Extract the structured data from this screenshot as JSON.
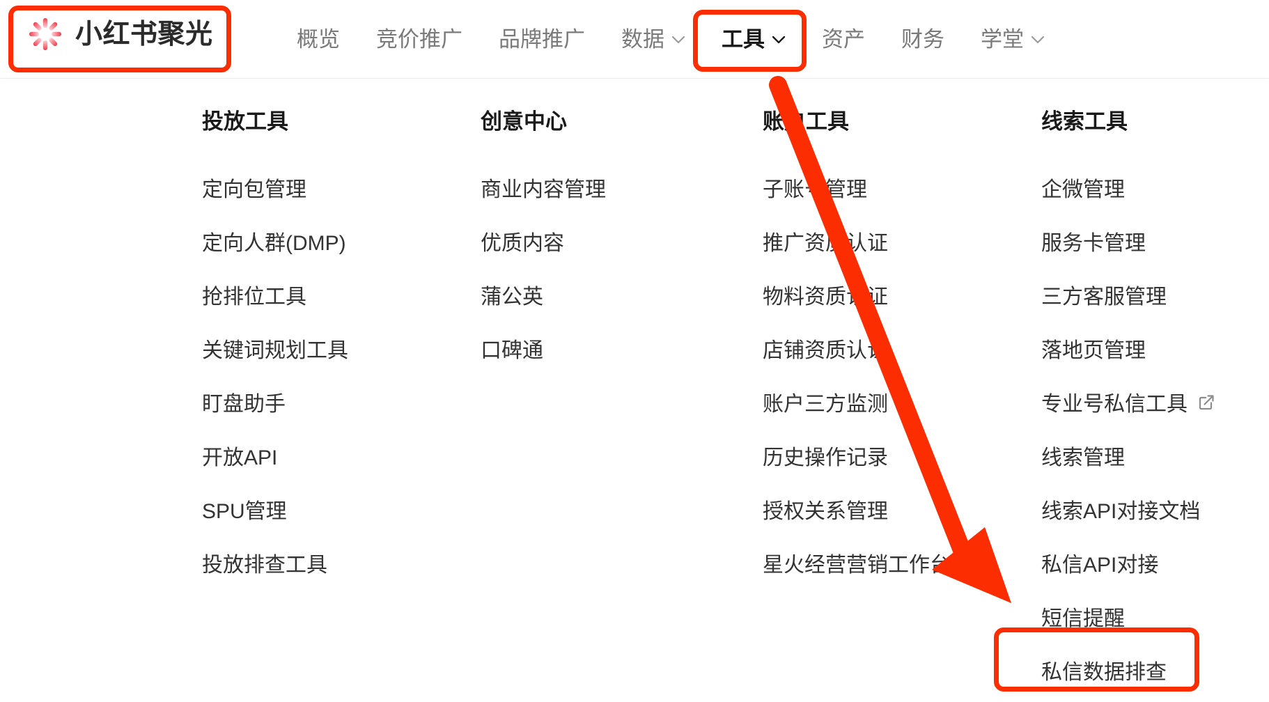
{
  "brand": {
    "name": "小红书聚光",
    "logo_icon": "starburst-icon",
    "logo_color": "#f7385b"
  },
  "annotation": {
    "color": "#fc2d00",
    "arrow_icon": "arrow-pointer",
    "boxed_items": [
      "小红书聚光",
      "工具",
      "私信数据排查"
    ]
  },
  "nav": {
    "items": [
      {
        "label": "概览",
        "has_chevron": false,
        "active": false
      },
      {
        "label": "竞价推广",
        "has_chevron": false,
        "active": false
      },
      {
        "label": "品牌推广",
        "has_chevron": false,
        "active": false
      },
      {
        "label": "数据",
        "has_chevron": true,
        "active": false
      },
      {
        "label": "工具",
        "has_chevron": true,
        "active": true
      },
      {
        "label": "资产",
        "has_chevron": false,
        "active": false
      },
      {
        "label": "财务",
        "has_chevron": false,
        "active": false
      },
      {
        "label": "学堂",
        "has_chevron": true,
        "active": false
      }
    ]
  },
  "dropdown": {
    "columns": [
      {
        "title": "投放工具",
        "items": [
          {
            "label": "定向包管理"
          },
          {
            "label": "定向人群(DMP)"
          },
          {
            "label": "抢排位工具"
          },
          {
            "label": "关键词规划工具"
          },
          {
            "label": "盯盘助手"
          },
          {
            "label": "开放API"
          },
          {
            "label": "SPU管理"
          },
          {
            "label": "投放排查工具"
          }
        ]
      },
      {
        "title": "创意中心",
        "items": [
          {
            "label": "商业内容管理"
          },
          {
            "label": "优质内容"
          },
          {
            "label": "蒲公英"
          },
          {
            "label": "口碑通"
          }
        ]
      },
      {
        "title": "账户工具",
        "items": [
          {
            "label": "子账号管理"
          },
          {
            "label": "推广资质认证"
          },
          {
            "label": "物料资质认证"
          },
          {
            "label": "店铺资质认证"
          },
          {
            "label": "账户三方监测"
          },
          {
            "label": "历史操作记录"
          },
          {
            "label": "授权关系管理"
          },
          {
            "label": "星火经营营销工作台"
          }
        ]
      },
      {
        "title": "线索工具",
        "items": [
          {
            "label": "企微管理"
          },
          {
            "label": "服务卡管理"
          },
          {
            "label": "三方客服管理"
          },
          {
            "label": "落地页管理"
          },
          {
            "label": "专业号私信工具",
            "external": true
          },
          {
            "label": "线索管理"
          },
          {
            "label": "线索API对接文档"
          },
          {
            "label": "私信API对接"
          },
          {
            "label": "短信提醒"
          },
          {
            "label": "私信数据排查",
            "highlighted": true
          }
        ]
      }
    ]
  }
}
